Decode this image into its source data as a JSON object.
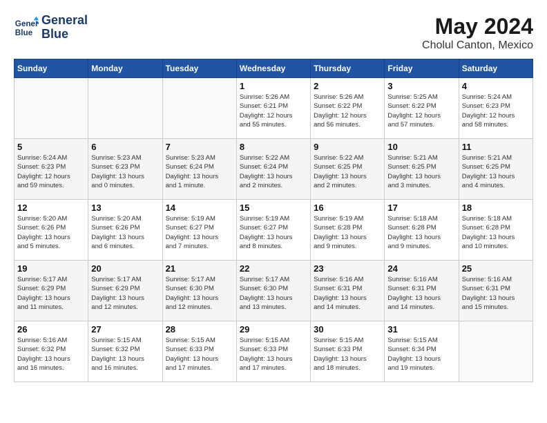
{
  "logo": {
    "line1": "General",
    "line2": "Blue"
  },
  "title": "May 2024",
  "location": "Cholul Canton, Mexico",
  "weekdays": [
    "Sunday",
    "Monday",
    "Tuesday",
    "Wednesday",
    "Thursday",
    "Friday",
    "Saturday"
  ],
  "weeks": [
    [
      {
        "day": "",
        "detail": ""
      },
      {
        "day": "",
        "detail": ""
      },
      {
        "day": "",
        "detail": ""
      },
      {
        "day": "1",
        "detail": "Sunrise: 5:26 AM\nSunset: 6:21 PM\nDaylight: 12 hours\nand 55 minutes."
      },
      {
        "day": "2",
        "detail": "Sunrise: 5:26 AM\nSunset: 6:22 PM\nDaylight: 12 hours\nand 56 minutes."
      },
      {
        "day": "3",
        "detail": "Sunrise: 5:25 AM\nSunset: 6:22 PM\nDaylight: 12 hours\nand 57 minutes."
      },
      {
        "day": "4",
        "detail": "Sunrise: 5:24 AM\nSunset: 6:23 PM\nDaylight: 12 hours\nand 58 minutes."
      }
    ],
    [
      {
        "day": "5",
        "detail": "Sunrise: 5:24 AM\nSunset: 6:23 PM\nDaylight: 12 hours\nand 59 minutes."
      },
      {
        "day": "6",
        "detail": "Sunrise: 5:23 AM\nSunset: 6:23 PM\nDaylight: 13 hours\nand 0 minutes."
      },
      {
        "day": "7",
        "detail": "Sunrise: 5:23 AM\nSunset: 6:24 PM\nDaylight: 13 hours\nand 1 minute."
      },
      {
        "day": "8",
        "detail": "Sunrise: 5:22 AM\nSunset: 6:24 PM\nDaylight: 13 hours\nand 2 minutes."
      },
      {
        "day": "9",
        "detail": "Sunrise: 5:22 AM\nSunset: 6:25 PM\nDaylight: 13 hours\nand 2 minutes."
      },
      {
        "day": "10",
        "detail": "Sunrise: 5:21 AM\nSunset: 6:25 PM\nDaylight: 13 hours\nand 3 minutes."
      },
      {
        "day": "11",
        "detail": "Sunrise: 5:21 AM\nSunset: 6:25 PM\nDaylight: 13 hours\nand 4 minutes."
      }
    ],
    [
      {
        "day": "12",
        "detail": "Sunrise: 5:20 AM\nSunset: 6:26 PM\nDaylight: 13 hours\nand 5 minutes."
      },
      {
        "day": "13",
        "detail": "Sunrise: 5:20 AM\nSunset: 6:26 PM\nDaylight: 13 hours\nand 6 minutes."
      },
      {
        "day": "14",
        "detail": "Sunrise: 5:19 AM\nSunset: 6:27 PM\nDaylight: 13 hours\nand 7 minutes."
      },
      {
        "day": "15",
        "detail": "Sunrise: 5:19 AM\nSunset: 6:27 PM\nDaylight: 13 hours\nand 8 minutes."
      },
      {
        "day": "16",
        "detail": "Sunrise: 5:19 AM\nSunset: 6:28 PM\nDaylight: 13 hours\nand 9 minutes."
      },
      {
        "day": "17",
        "detail": "Sunrise: 5:18 AM\nSunset: 6:28 PM\nDaylight: 13 hours\nand 9 minutes."
      },
      {
        "day": "18",
        "detail": "Sunrise: 5:18 AM\nSunset: 6:28 PM\nDaylight: 13 hours\nand 10 minutes."
      }
    ],
    [
      {
        "day": "19",
        "detail": "Sunrise: 5:17 AM\nSunset: 6:29 PM\nDaylight: 13 hours\nand 11 minutes."
      },
      {
        "day": "20",
        "detail": "Sunrise: 5:17 AM\nSunset: 6:29 PM\nDaylight: 13 hours\nand 12 minutes."
      },
      {
        "day": "21",
        "detail": "Sunrise: 5:17 AM\nSunset: 6:30 PM\nDaylight: 13 hours\nand 12 minutes."
      },
      {
        "day": "22",
        "detail": "Sunrise: 5:17 AM\nSunset: 6:30 PM\nDaylight: 13 hours\nand 13 minutes."
      },
      {
        "day": "23",
        "detail": "Sunrise: 5:16 AM\nSunset: 6:31 PM\nDaylight: 13 hours\nand 14 minutes."
      },
      {
        "day": "24",
        "detail": "Sunrise: 5:16 AM\nSunset: 6:31 PM\nDaylight: 13 hours\nand 14 minutes."
      },
      {
        "day": "25",
        "detail": "Sunrise: 5:16 AM\nSunset: 6:31 PM\nDaylight: 13 hours\nand 15 minutes."
      }
    ],
    [
      {
        "day": "26",
        "detail": "Sunrise: 5:16 AM\nSunset: 6:32 PM\nDaylight: 13 hours\nand 16 minutes."
      },
      {
        "day": "27",
        "detail": "Sunrise: 5:15 AM\nSunset: 6:32 PM\nDaylight: 13 hours\nand 16 minutes."
      },
      {
        "day": "28",
        "detail": "Sunrise: 5:15 AM\nSunset: 6:33 PM\nDaylight: 13 hours\nand 17 minutes."
      },
      {
        "day": "29",
        "detail": "Sunrise: 5:15 AM\nSunset: 6:33 PM\nDaylight: 13 hours\nand 17 minutes."
      },
      {
        "day": "30",
        "detail": "Sunrise: 5:15 AM\nSunset: 6:33 PM\nDaylight: 13 hours\nand 18 minutes."
      },
      {
        "day": "31",
        "detail": "Sunrise: 5:15 AM\nSunset: 6:34 PM\nDaylight: 13 hours\nand 19 minutes."
      },
      {
        "day": "",
        "detail": ""
      }
    ]
  ]
}
